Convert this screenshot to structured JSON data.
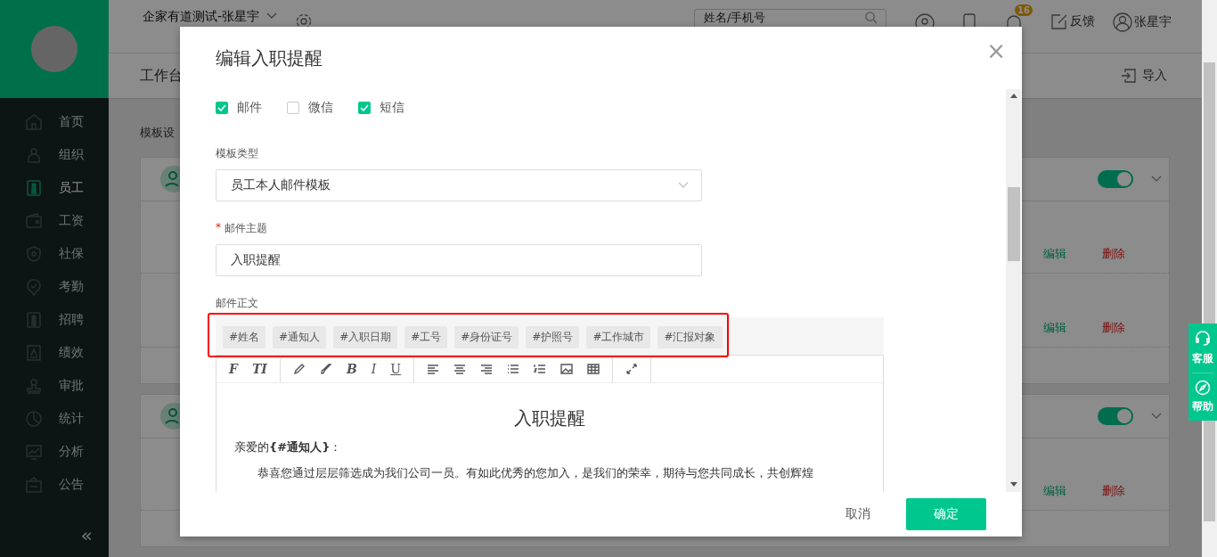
{
  "header": {
    "company": "企家有道测试-张星宇",
    "search": {
      "placeholder": "姓名/手机号"
    },
    "badge": "16",
    "feedback": "反馈",
    "user": "张星宇"
  },
  "sidebar": {
    "items": [
      {
        "label": "首页",
        "kind": "home",
        "selected": false
      },
      {
        "label": "组织",
        "kind": "people",
        "selected": false
      },
      {
        "label": "员工",
        "kind": "staff",
        "selected": true
      },
      {
        "label": "工资",
        "kind": "wallet",
        "selected": false
      },
      {
        "label": "社保",
        "kind": "shield",
        "selected": false
      },
      {
        "label": "考勤",
        "kind": "pin",
        "selected": false
      },
      {
        "label": "招聘",
        "kind": "staff",
        "selected": false
      },
      {
        "label": "绩效",
        "kind": "doc",
        "selected": false
      },
      {
        "label": "审批",
        "kind": "stamp",
        "selected": false
      },
      {
        "label": "统计",
        "kind": "pie",
        "selected": false
      },
      {
        "label": "分析",
        "kind": "screen",
        "selected": false
      },
      {
        "label": "公告",
        "kind": "board",
        "selected": false
      }
    ],
    "collapse": "«"
  },
  "subbar": {
    "title": "工作台",
    "import": "导入"
  },
  "section_title": "模板设",
  "cards": [
    {
      "on": true,
      "rows": [
        {
          "edit": "编辑",
          "delete": "删除"
        },
        {
          "edit": "编辑",
          "delete": "删除"
        }
      ]
    },
    {
      "on": true,
      "rows": [
        {
          "edit": "编辑",
          "delete": "删除"
        }
      ]
    }
  ],
  "modal": {
    "title": "编辑入职提醒",
    "close": "×",
    "channels": [
      {
        "label": "邮件",
        "checked": true
      },
      {
        "label": "微信",
        "checked": false
      },
      {
        "label": "短信",
        "checked": true
      }
    ],
    "template_type": {
      "label": "模板类型",
      "value": "员工本人邮件模板"
    },
    "subject": {
      "required_mark": "*",
      "label": "邮件主题",
      "value": "入职提醒"
    },
    "body": {
      "label": "邮件正文",
      "tags_highlighted": true,
      "tags": [
        "#姓名",
        "#通知人",
        "#入职日期",
        "#工号",
        "#身份证号",
        "#护照号",
        "#工作城市",
        "#汇报对象"
      ],
      "toolbar": [
        [
          {
            "kind": "glyph",
            "label": "F"
          },
          {
            "kind": "glyph",
            "label": "TI"
          }
        ],
        [
          {
            "kind": "pencil"
          },
          {
            "kind": "brush"
          },
          {
            "kind": "glyph",
            "label": "B"
          },
          {
            "kind": "glyph",
            "label": "I"
          },
          {
            "kind": "glyph",
            "label": "U"
          }
        ],
        [
          {
            "kind": "align-left"
          },
          {
            "kind": "align-center"
          },
          {
            "kind": "align-right"
          },
          {
            "kind": "bullets"
          },
          {
            "kind": "numbers"
          },
          {
            "kind": "image"
          },
          {
            "kind": "table"
          }
        ],
        [
          {
            "kind": "fullscreen"
          }
        ]
      ],
      "content": {
        "heading": "入职提醒",
        "greeting": "亲爱的**{#通知人}**：",
        "paragraph": "恭喜您通过层层筛选成为我们公司一员。有如此优秀的您加入，是我们的荣幸，期待与您共同成长，共创辉煌"
      }
    },
    "cancel": "取消",
    "confirm": "确定"
  },
  "float_panel": [
    {
      "label": "客服",
      "kind": "headset"
    },
    {
      "label": "帮助",
      "kind": "compass"
    }
  ]
}
